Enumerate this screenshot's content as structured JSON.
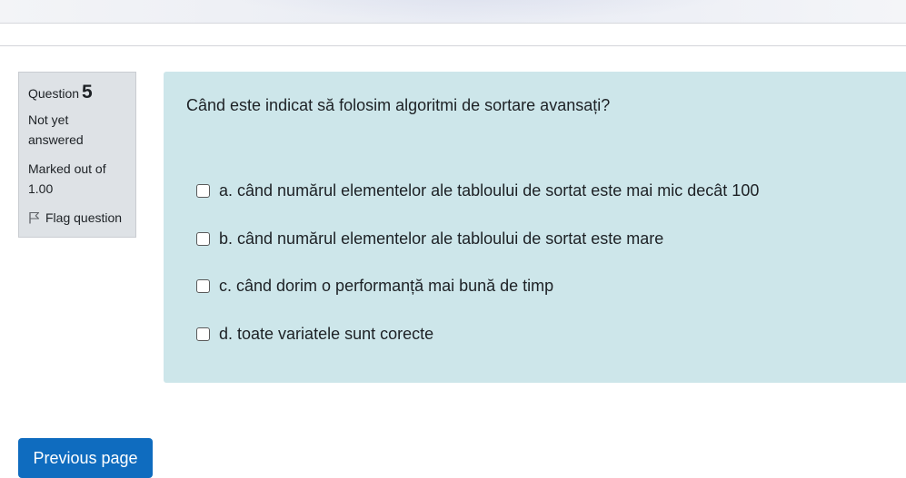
{
  "question_info": {
    "label": "Question",
    "number": "5",
    "state": "Not yet answered",
    "grade": "Marked out of 1.00",
    "flag_label": "Flag question"
  },
  "question": {
    "text": "Când este indicat să folosim algoritmi de sortare avansați?",
    "answers": [
      {
        "label": "a. când numărul elementelor ale tabloului de sortat este mai mic decât 100",
        "checked": false
      },
      {
        "label": "b. când numărul elementelor ale tabloului de sortat este mare",
        "checked": false
      },
      {
        "label": "c. când dorim o performanță mai bună de timp",
        "checked": false
      },
      {
        "label": "d. toate variatele sunt corecte",
        "checked": false
      }
    ]
  },
  "navigation": {
    "previous_label": "Previous page"
  },
  "colors": {
    "content_bg": "#cde6ea",
    "info_bg": "#dee2e6",
    "primary": "#0f6cbf"
  },
  "icons": {
    "flag": "flag-icon",
    "checkbox": "checkbox"
  }
}
